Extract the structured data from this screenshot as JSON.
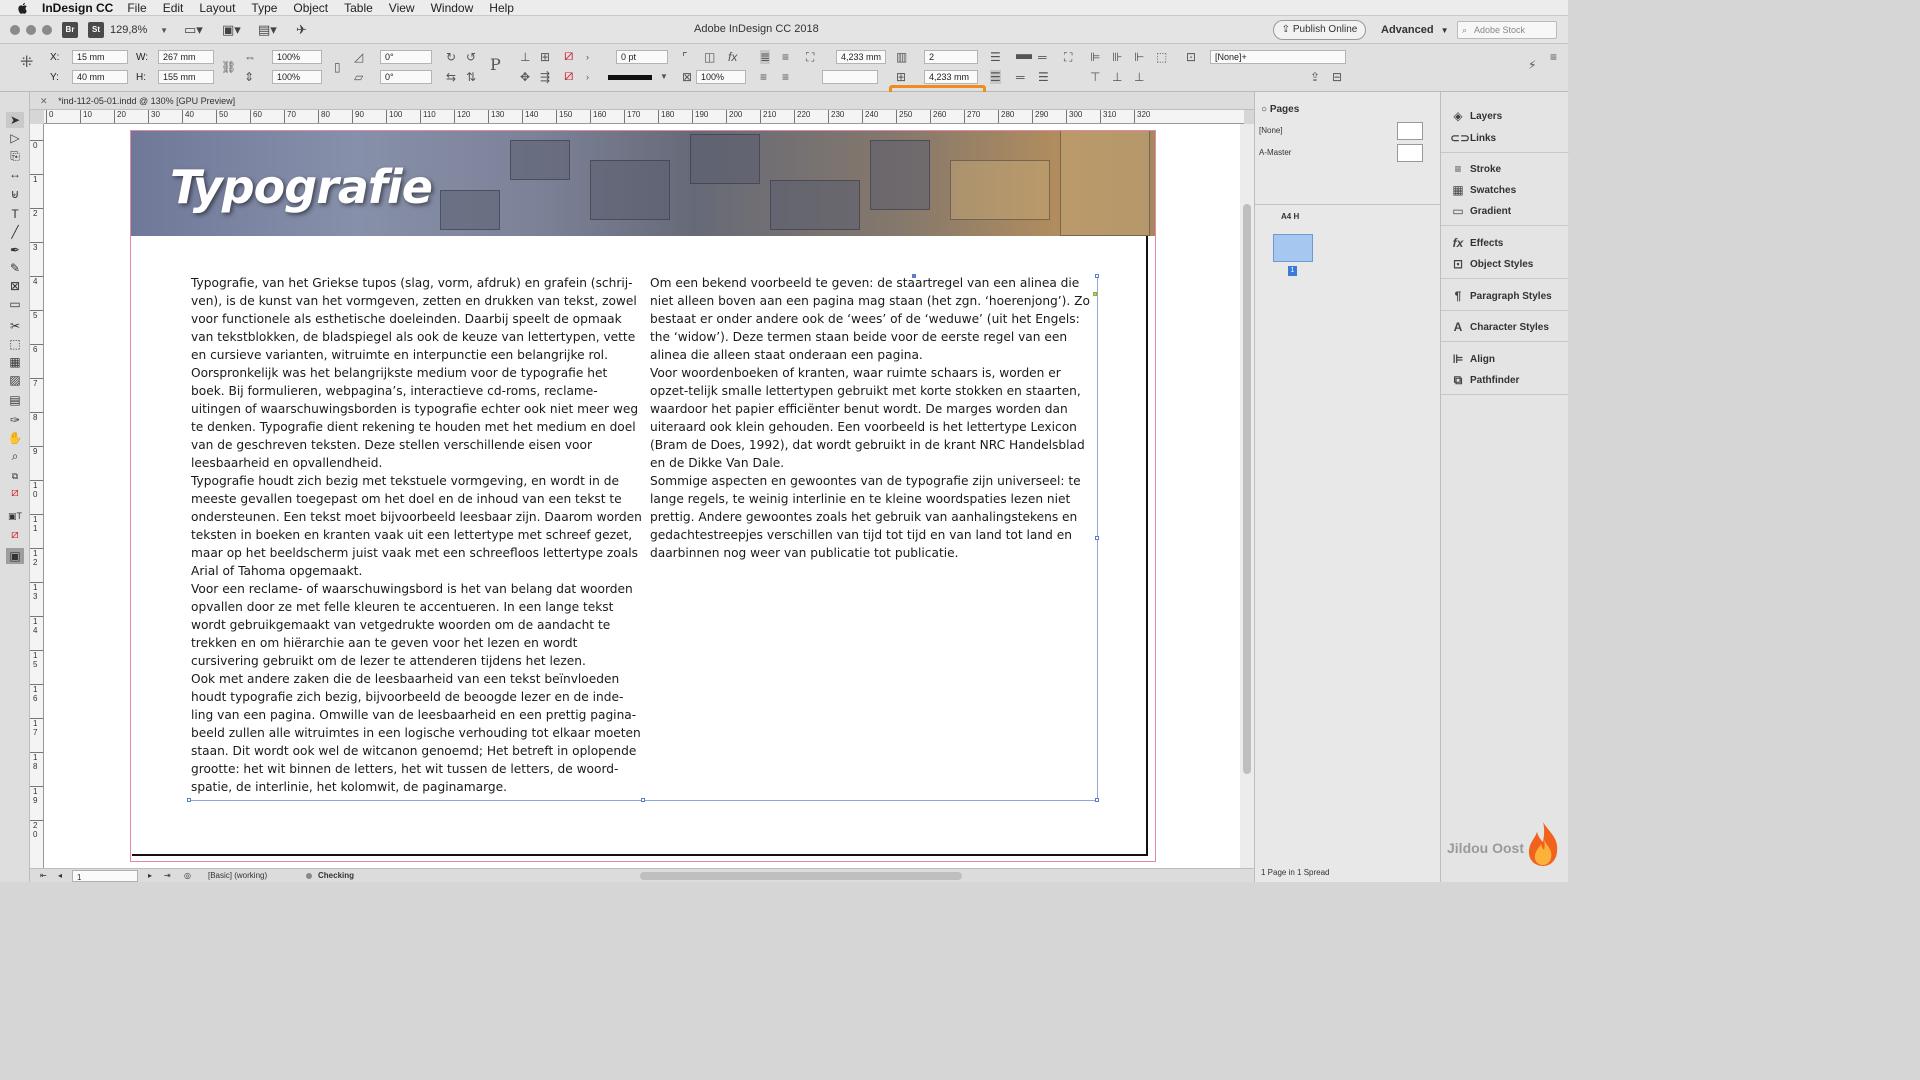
{
  "menubar": {
    "app_name": "InDesign CC",
    "items": [
      "File",
      "Edit",
      "Layout",
      "Type",
      "Object",
      "Table",
      "View",
      "Window",
      "Help"
    ]
  },
  "titlebar": {
    "badge_bridge": "Br",
    "badge_stock": "St",
    "zoom": "129,8%",
    "doc_title": "Adobe InDesign CC 2018",
    "publish_label": "Publish Online",
    "workspace_label": "Advanced",
    "stock_placeholder": "Adobe Stock"
  },
  "control": {
    "x_label": "X:",
    "x_value": "15 mm",
    "y_label": "Y:",
    "y_value": "40 mm",
    "w_label": "W:",
    "w_value": "267 mm",
    "h_label": "H:",
    "h_value": "155 mm",
    "scale_x": "100%",
    "scale_y": "100%",
    "rotate": "0°",
    "shear": "0°",
    "stroke_weight": "0 pt",
    "opacity": "100%",
    "gutter_top": "4,233 mm",
    "columns": "2",
    "gutter_bottom": "4,233 mm",
    "object_style": "[None]+"
  },
  "tab": {
    "title": "*ind-112-05-01.indd @ 130% [GPU Preview]"
  },
  "ruler": {
    "h_labels": [
      "0",
      "10",
      "20",
      "30",
      "40",
      "50",
      "60",
      "70",
      "80",
      "90",
      "100",
      "110",
      "120",
      "130",
      "140",
      "150",
      "160",
      "170",
      "180",
      "190",
      "200",
      "210",
      "220",
      "230",
      "240",
      "250",
      "260",
      "270",
      "280",
      "290",
      "300",
      "310",
      "320"
    ],
    "v_labels": [
      "0",
      "1",
      "2",
      "3",
      "4",
      "5",
      "6",
      "7",
      "8",
      "9",
      "10",
      "11",
      "12",
      "13",
      "14",
      "15",
      "16",
      "17",
      "18",
      "19",
      "20"
    ]
  },
  "document": {
    "heading": "Typografie",
    "col1": [
      "Typografie, van het Griekse tupos (slag, vorm, afdruk) en grafein (schrij-ven), is de kunst van het vormgeven, zetten en drukken van tekst, zowel voor functionele als esthetische doeleinden. Daarbij speelt de opmaak van tekstblokken, de bladspiegel als ook de keuze van lettertypen, vette en cursieve varianten, witruimte en interpunctie een belangrijke rol.",
      "Oorspronkelijk was het belangrijkste medium voor de typografie het boek. Bij formulieren, webpagina’s, interactieve cd-roms, reclame-uitingen of waarschuwingsborden is typografie echter ook niet meer weg te denken. Typografie dient rekening te houden met het medium en doel van de geschreven teksten. Deze stellen verschillende eisen voor leesbaarheid en opvallendheid.",
      "Typografie houdt zich bezig met tekstuele vormgeving, en wordt in de meeste gevallen toegepast om het doel en de inhoud van een tekst te ondersteunen. Een tekst moet bijvoorbeeld leesbaar zijn. Daarom worden teksten in boeken en kranten vaak uit een lettertype met schreef gezet, maar op het beeldscherm juist vaak met een schreefloos lettertype zoals Arial of Tahoma opgemaakt.",
      "Voor een reclame- of waarschuwingsbord is het van belang dat woorden opvallen door ze met felle kleuren te accentueren. In een lange tekst wordt gebruikgemaakt van vetgedrukte woorden om de aandacht te trekken en om hiërarchie aan te geven voor het lezen en wordt cursivering gebruikt om de lezer te attenderen tijdens het lezen.",
      "Ook met andere zaken die de leesbaarheid van een tekst beïnvloeden houdt typografie zich bezig, bijvoorbeeld de beoogde lezer en de inde-ling van een pagina. Omwille van de leesbaarheid en een prettig pagina-beeld zullen alle witruimtes in een logische verhouding tot elkaar moeten staan. Dit wordt ook wel de witcanon genoemd; Het betreft in oplopende grootte: het wit binnen de letters, het wit tussen de letters, de woord-spatie, de interlinie, het kolomwit, de paginamarge."
    ],
    "col2": [
      "Om een bekend voorbeeld te geven: de staartregel van een alinea die niet alleen boven aan een pagina mag staan (het zgn. ‘hoerenjong’). Zo bestaat er onder andere ook de ‘wees’ of de ‘weduwe’ (uit het Engels: the ‘widow’). Deze termen staan beide voor de eerste regel van een alinea die alleen staat onderaan een pagina.",
      "Voor woordenboeken of kranten, waar ruimte schaars is, worden er opzet-telijk smalle lettertypen gebruikt met korte stokken en staarten, waardoor het papier efficiënter benut wordt. De marges worden dan uiteraard ook klein gehouden. Een voorbeeld is het lettertype Lexicon (Bram de Does, 1992), dat wordt gebruikt in de krant NRC Handelsblad en de Dikke Van Dale.",
      "Sommige aspecten en gewoontes van de typografie zijn universeel: te lange regels, te weinig interlinie en te kleine woordspaties lezen niet prettig. Andere gewoontes zoals het gebruik van aanhalingstekens en gedachtestreepjes verschillen van tijd tot tijd en van land tot land en daarbinnen nog weer van publicatie tot publicatie."
    ]
  },
  "statusbar": {
    "page": "1",
    "style": "[Basic] (working)",
    "preflight": "Checking"
  },
  "pages_panel": {
    "tab_label": "Pages",
    "none_label": "[None]",
    "master_label": "A-Master",
    "size_label": "A4 H",
    "master_letter": "A",
    "page_number": "1",
    "footer": "1 Page in 1 Spread"
  },
  "dock": {
    "items": [
      "Layers",
      "Links",
      "Stroke",
      "Swatches",
      "Gradient",
      "Effects",
      "Object Styles",
      "Paragraph Styles",
      "Character Styles",
      "Align",
      "Pathfinder"
    ],
    "icons": [
      "layers-icon",
      "links-icon",
      "stroke-icon",
      "swatches-icon",
      "gradient-icon",
      "effects-icon",
      "object-styles-icon",
      "paragraph-styles-icon",
      "character-styles-icon",
      "align-icon",
      "pathfinder-icon"
    ],
    "watermark": "Jildou Oost"
  },
  "colors": {
    "highlight": "#f08c1e",
    "page_thumb": "#a6c8f0",
    "frame_outline": "#8fa8d8"
  }
}
